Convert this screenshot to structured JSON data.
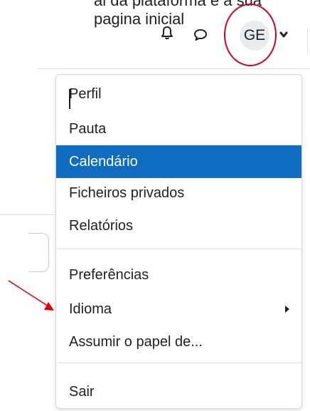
{
  "header": {
    "page_text": "al da plataforma e a sua pagina inicial",
    "avatar_initials": "GE"
  },
  "menu": {
    "items": [
      {
        "label": "Perfil"
      },
      {
        "label": "Pauta"
      },
      {
        "label": "Calendário"
      },
      {
        "label": "Ficheiros privados"
      },
      {
        "label": "Relatórios"
      },
      {
        "label": "Preferências"
      },
      {
        "label": "Idioma"
      },
      {
        "label": "Assumir o papel de..."
      },
      {
        "label": "Sair"
      }
    ],
    "active_item": "Calendário"
  },
  "colors": {
    "active_bg": "#0f6cbf",
    "annotation": "#d0021b"
  },
  "icons": [
    "bell-icon",
    "chat-icon",
    "chevron-down-icon",
    "caret-right-icon",
    "red-arrow-annotation"
  ]
}
